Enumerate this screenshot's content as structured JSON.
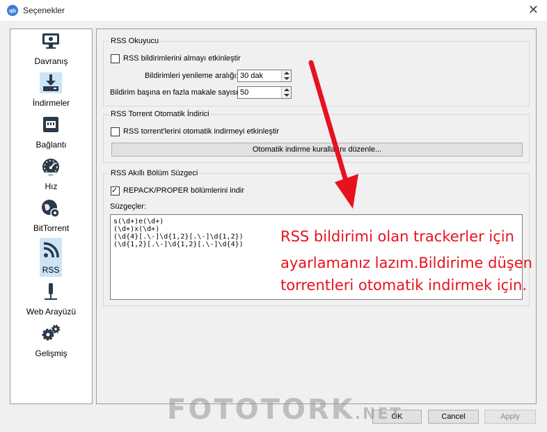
{
  "window": {
    "title": "Seçenekler",
    "app_icon_text": "qb",
    "close_glyph": "✕"
  },
  "sidebar": {
    "items": [
      {
        "label": "Davranış",
        "icon": "monitor-icon"
      },
      {
        "label": "İndirmeler",
        "icon": "download-icon"
      },
      {
        "label": "Bağlantı",
        "icon": "network-port-icon"
      },
      {
        "label": "Hız",
        "icon": "speedometer-icon"
      },
      {
        "label": "BitTorrent",
        "icon": "globe-gear-icon"
      },
      {
        "label": "RSS",
        "icon": "rss-icon"
      },
      {
        "label": "Web Arayüzü",
        "icon": "webui-icon"
      },
      {
        "label": "Gelişmiş",
        "icon": "gears-icon"
      }
    ],
    "selected": "RSS"
  },
  "rss_reader": {
    "title": "RSS Okuyucu",
    "enable_fetch_label": "RSS bildirimlerini almayı etkinleştir",
    "enable_fetch_checked": false,
    "refresh_label": "Bildirimleri yenileme aralığı:",
    "refresh_value": "30 dak",
    "max_articles_label": "Bildirim başına en fazla makale sayısı:",
    "max_articles_value": "50"
  },
  "auto_downloader": {
    "title": "RSS Torrent Otomatik İndirici",
    "enable_label": "RSS torrent'lerini otomatik indirmeyi etkinleştir",
    "enable_checked": false,
    "edit_rules_button": "Otomatik indirme kurallarını düzenle..."
  },
  "smart_filter": {
    "title": "RSS Akıllı Bölüm Süzgeci",
    "repack_label": "REPACK/PROPER bölümlerini indir",
    "repack_checked": true,
    "filters_label": "Süzgeçler:",
    "filters_text": "s(\\d+)e(\\d+)\n(\\d+)x(\\d+)\n(\\d{4}[.\\-]\\d{1,2}[.\\-]\\d{1,2})\n(\\d{1,2}[.\\-]\\d{1,2}[.\\-]\\d{4})"
  },
  "annotation": {
    "line1": "RSS bildirimi olan trackerler için",
    "line2": "ayarlamanız lazım.Bildirime düşen",
    "line3": "torrentleri otomatik indirmek için."
  },
  "watermark": {
    "text": "FOTOTORK",
    "suffix": ".NET"
  },
  "buttons": {
    "ok": "OK",
    "cancel": "Cancel",
    "apply": "Apply",
    "apply_enabled": false
  },
  "colors": {
    "accent_selected": "#cce4f7",
    "annotation_red": "#e8111e",
    "icon_dark": "#2b3a4a"
  }
}
